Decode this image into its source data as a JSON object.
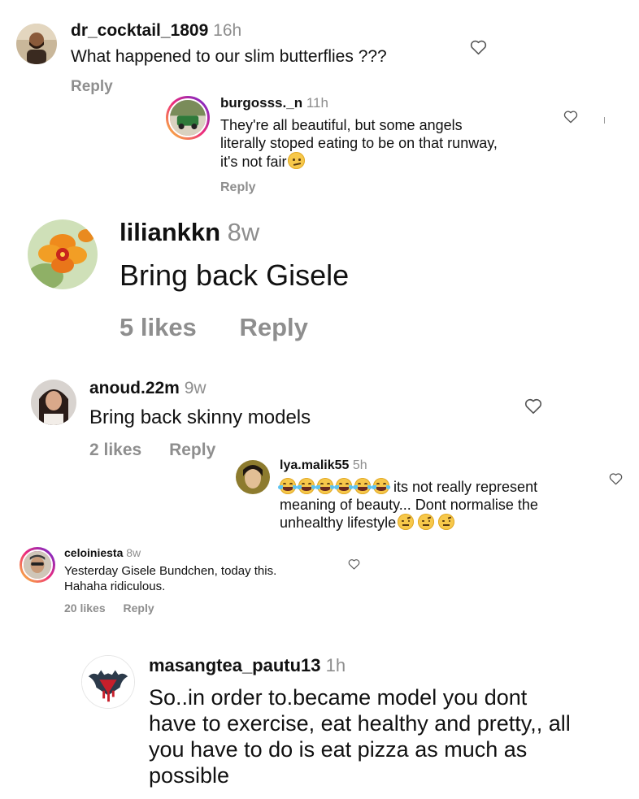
{
  "comments": [
    {
      "username": "dr_cocktail_1809",
      "time": "16h",
      "text": "What happened to our slim butterflies ???",
      "reply_label": "Reply",
      "avatar": "man-with-beard-avatar"
    },
    {
      "username": "burgosss._n",
      "time": "11h",
      "text_line1": "They're all beautiful, but some angels",
      "text_line2": "literally stoped eating to be on that runway,",
      "text_line3": "it's not fair",
      "emoji": "confused-face",
      "reply_label": "Reply",
      "avatar": "green-car-avatar"
    },
    {
      "username": "liliankkn",
      "time": "8w",
      "text": "Bring back Gisele",
      "likes": "5 likes",
      "reply_label": "Reply",
      "avatar": "orange-orchid-avatar"
    },
    {
      "username": "anoud.22m",
      "time": "9w",
      "text": "Bring back skinny models",
      "likes": "2 likes",
      "reply_label": "Reply",
      "avatar": "woman-portrait-avatar"
    },
    {
      "username": "lya.malik55",
      "time": "5h",
      "text_line1": " its not really represent",
      "text_line2": "meaning of beauty... Dont normalise the",
      "text_line3": "unhealthy lifestyle",
      "emoji_laugh_count": 6,
      "emoji_raised_count": 3,
      "avatar": "woman-selfie-avatar"
    },
    {
      "username": "celoiniesta",
      "time": "8w",
      "text_line1": "Yesterday Gisele Bundchen, today this.",
      "text_line2": "Hahaha ridiculous.",
      "likes": "20 likes",
      "reply_label": "Reply",
      "avatar": "man-sunglasses-avatar"
    },
    {
      "username": "masangtea_pautu13",
      "time": "1h",
      "text_line1": "So..in order to.became model you dont",
      "text_line2": "have to exercise, eat healthy and pretty,, all",
      "text_line3": "you have to do is eat pizza as much as",
      "text_line4": "possible",
      "avatar": "batman-superman-logo-avatar"
    }
  ],
  "colors": {
    "text": "#111111",
    "muted": "#8e8e8e",
    "story_ring_start": "#f9ce34",
    "story_ring_mid": "#ee2a7b",
    "story_ring_end": "#6228d7"
  },
  "icons": {
    "like": "heart-outline-icon"
  }
}
